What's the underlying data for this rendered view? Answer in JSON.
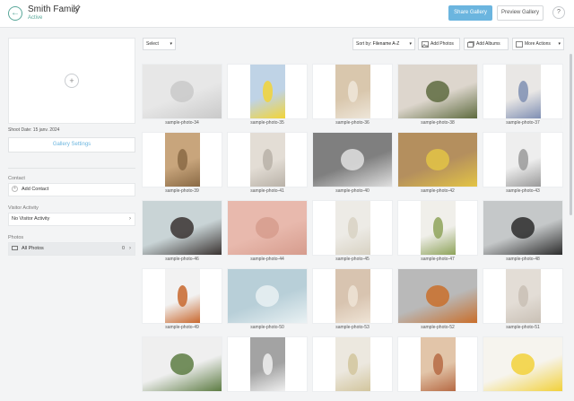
{
  "header": {
    "title": "Smith Family",
    "status": "Active",
    "share_label": "Share Gallery",
    "preview_label": "Preview Gallery",
    "help_label": "?"
  },
  "sidebar": {
    "shoot_date": "Shoot Date: 15 janv. 2024",
    "settings_label": "Gallery Settings",
    "contact_heading": "Contact",
    "add_contact_label": "Add Contact",
    "visitor_heading": "Visitor Activity",
    "visitor_value": "No Visitor Activity",
    "photos_heading": "Photos",
    "all_photos_label": "All Photos",
    "all_photos_count": "0"
  },
  "toolbar": {
    "select_label": "Select",
    "sort_label": "Sort by:",
    "sort_value": "Filename A-Z",
    "add_photos": "Add Photos",
    "add_albums": "Add Albums",
    "more_actions": "More Actions"
  },
  "photos": [
    {
      "name": "sample-photo-34",
      "bg": "#e7e7e7",
      "fg": "#c9c9c9",
      "orient": "land"
    },
    {
      "name": "sample-photo-35",
      "bg": "#bfd3e6",
      "fg": "#f2d437",
      "orient": "port"
    },
    {
      "name": "sample-photo-36",
      "bg": "#d9c7ad",
      "fg": "#eee6d9",
      "orient": "port"
    },
    {
      "name": "sample-photo-38",
      "bg": "#ddd6cd",
      "fg": "#5e6b3f",
      "orient": "land"
    },
    {
      "name": "sample-photo-37",
      "bg": "#e9e7e5",
      "fg": "#7f8fb3",
      "orient": "port"
    },
    {
      "name": "sample-photo-39",
      "bg": "#c8a57c",
      "fg": "#8a6a45",
      "orient": "port"
    },
    {
      "name": "sample-photo-41",
      "bg": "#e3ddd5",
      "fg": "#b9b2a8",
      "orient": "port"
    },
    {
      "name": "sample-photo-40",
      "bg": "#7f7f7f",
      "fg": "#e0e0e0",
      "orient": "land"
    },
    {
      "name": "sample-photo-42",
      "bg": "#b48f5e",
      "fg": "#e3c445",
      "orient": "land"
    },
    {
      "name": "sample-photo-43",
      "bg": "#eeeeee",
      "fg": "#9a9a9a",
      "orient": "port"
    },
    {
      "name": "sample-photo-46",
      "bg": "#c9d4d6",
      "fg": "#3a3331",
      "orient": "land"
    },
    {
      "name": "sample-photo-44",
      "bg": "#e8b9ad",
      "fg": "#d69c8d",
      "orient": "land"
    },
    {
      "name": "sample-photo-45",
      "bg": "#edebe6",
      "fg": "#d8d2c3",
      "orient": "port"
    },
    {
      "name": "sample-photo-47",
      "bg": "#f0efea",
      "fg": "#8ea35a",
      "orient": "port"
    },
    {
      "name": "sample-photo-48",
      "bg": "#c5c8c9",
      "fg": "#2c2c2c",
      "orient": "land"
    },
    {
      "name": "sample-photo-49",
      "bg": "#f2f2f2",
      "fg": "#c8672d",
      "orient": "port"
    },
    {
      "name": "sample-photo-50",
      "bg": "#b8cfd8",
      "fg": "#e9f1f3",
      "orient": "land"
    },
    {
      "name": "sample-photo-53",
      "bg": "#d8c4b0",
      "fg": "#efe4d6",
      "orient": "port"
    },
    {
      "name": "sample-photo-52",
      "bg": "#b9b9b9",
      "fg": "#c96e2a",
      "orient": "land"
    },
    {
      "name": "sample-photo-51",
      "bg": "#e3ddd6",
      "fg": "#c9c0b5",
      "orient": "port"
    },
    {
      "name": "",
      "bg": "#efefef",
      "fg": "#5d7c43",
      "orient": "land"
    },
    {
      "name": "",
      "bg": "#a3a3a3",
      "fg": "#f0f0f0",
      "orient": "port"
    },
    {
      "name": "",
      "bg": "#ece8df",
      "fg": "#d2c59d",
      "orient": "port"
    },
    {
      "name": "",
      "bg": "#e2c5a9",
      "fg": "#b66a44",
      "orient": "port"
    },
    {
      "name": "",
      "bg": "#f6f4ee",
      "fg": "#f2d13a",
      "orient": "land"
    }
  ],
  "colors": {
    "accent": "#6bb5df",
    "status": "#5aa89a"
  }
}
